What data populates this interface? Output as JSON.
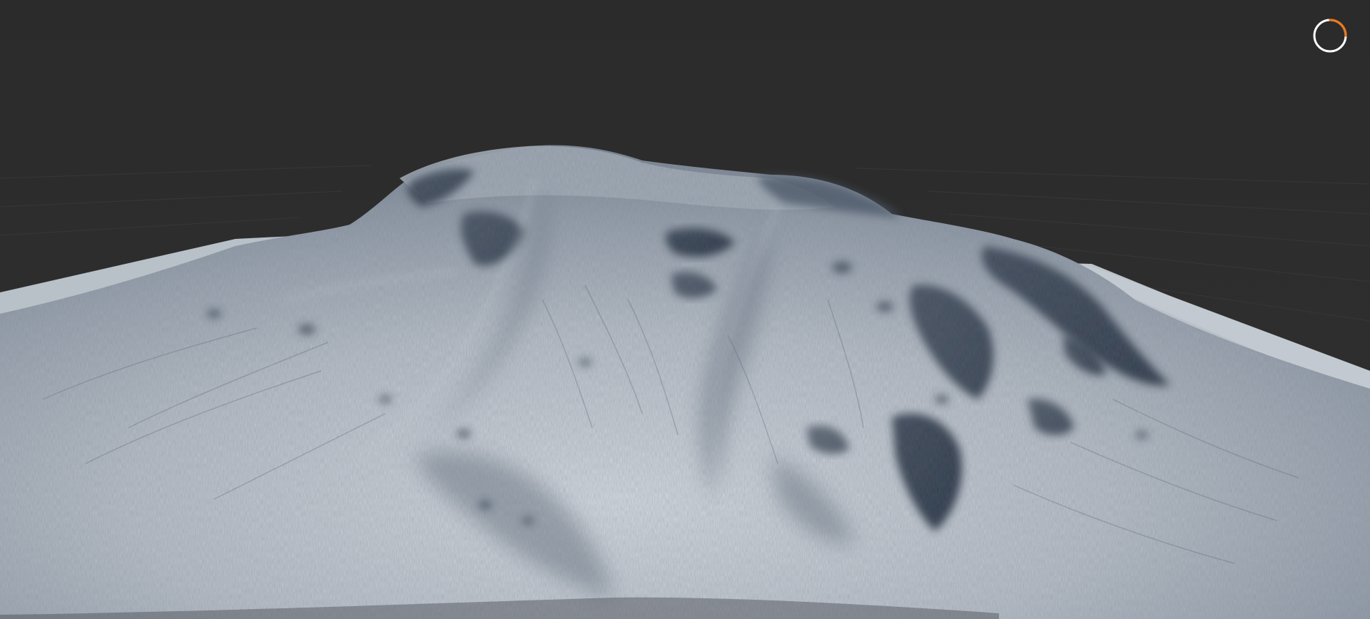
{
  "viewport": {
    "background_color": "#2d2d2d",
    "grid_color": "#3a3a3a",
    "terrain_light_color": "#c9cfd6",
    "terrain_mid_color": "#8e98a5",
    "terrain_dark_color": "#273140"
  },
  "progress_indicator": {
    "icon": "loading-spinner-icon",
    "progress": 0.25,
    "track_color": "#ffffff",
    "accent_color": "#e8781e"
  }
}
